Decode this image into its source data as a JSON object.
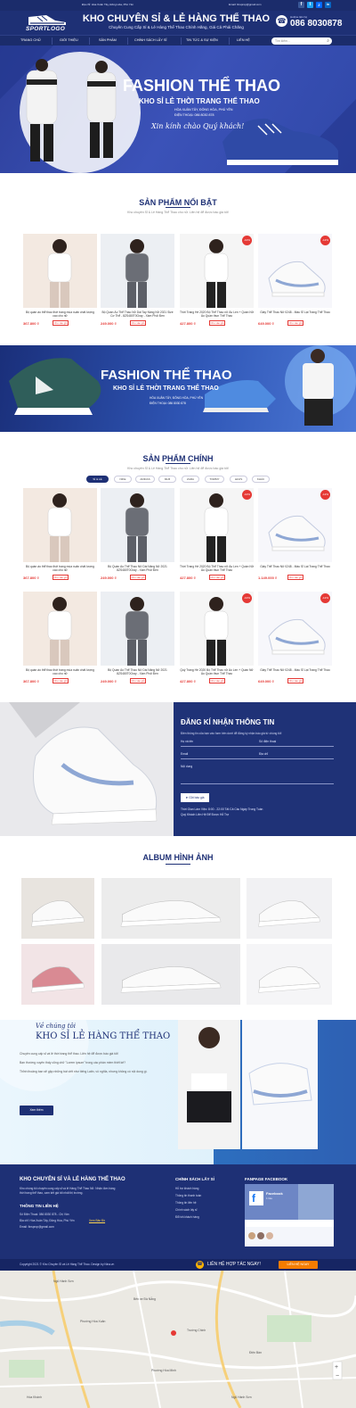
{
  "topbar": {
    "address": "Địa chỉ: Hòa Xuân Tây, Đông Hòa, Phú Yên",
    "email": "Email: ltnsprop@gmail.com",
    "social": [
      {
        "name": "facebook-icon",
        "glyph": "f",
        "color": "#3b5998"
      },
      {
        "name": "twitter-icon",
        "glyph": "t",
        "color": "#1da1f2"
      },
      {
        "name": "zalo-icon",
        "glyph": "Z",
        "color": "#0068ff"
      },
      {
        "name": "linkedin-icon",
        "glyph": "in",
        "color": "#0a66c2"
      }
    ]
  },
  "header": {
    "logo_text": "SPORTLOGO",
    "title": "KHO CHUYÊN SỈ & LẺ HÀNG THỂ THAO",
    "subtitle": "Chuyên Cung Cấp Sỉ & Lẻ Hàng Thể Thao Chính Hãng, Giá Cả Phải Chăng",
    "hotline_label": "Hotline liên hệ",
    "hotline": "086 8030878"
  },
  "nav": {
    "items": [
      "TRANG CHỦ",
      "GIỚI THIỆU",
      "SẢN PHẨM",
      "CHÍNH SÁCH LẤY SỈ",
      "TIN TỨC & SỰ KIỆN",
      "LIÊN HỆ"
    ],
    "search_placeholder": "Tìm kiếm..."
  },
  "banner1": {
    "title": "FASHION THỂ THAO",
    "subtitle": "KHO SỈ LẺ THỜI TRANG THỂ THAO",
    "address": "HÒA XUÂN TÂY, ĐÔNG HÒA, PHÚ YÊN",
    "phone": "ĐIỆN THOẠI: 086 8030 878",
    "greeting": "Xin kính chào Quý khách!"
  },
  "featured": {
    "title": "SẢN PHẨM NỔI BẬT",
    "subtitle": "Kho chuyên Sỉ & Lẻ Hàng Thể Thao cho nữ. Liên hệ để được báo giá tốt!",
    "cart_label": "Cho vào giỏ",
    "products": [
      {
        "name": "Bộ quần áo thể thao thời trang mùa xuân chất lượng cao cho nữ",
        "price": "367.800 ₫",
        "sale": ""
      },
      {
        "name": "Bộ Quần Áo Thể Thao Nữ Dài Tay Nâng Nữ 2021 Size Cơ Thể - 8ZS480T0Gray - Xám Phối Đen",
        "price": "249.000 ₫",
        "sale": ""
      },
      {
        "name": "Thời Trang Hè 2020 Bộ Thể Thao nữ Áo Len + Quần Nữ Áo Quần thun Thể Thao",
        "price": "427.800 ₫",
        "sale": "-10%"
      },
      {
        "name": "Giày Thể Thao Nữ 0248 - Màu Sĩ Lạt Trang Thể Thao",
        "price": "649.000 ₫",
        "sale": "-12%"
      }
    ]
  },
  "banner2": {
    "title": "FASHION THỂ THAO",
    "subtitle": "KHO SỈ LẺ THỜI TRANG THỂ THAO",
    "address": "HÒA XUÂN TÂY, ĐÔNG HÒA, PHÚ YÊN",
    "phone": "ĐIỆN THOẠI: 086 8030 878"
  },
  "main": {
    "title": "SẢN PHẨM CHÍNH",
    "subtitle": "Kho chuyên Sỉ & Lẻ Hàng Thể Thao cho nữ. Liên hệ để được báo giá tốt!",
    "tabs": [
      "SỈ & LẺ",
      "NIKE",
      "ADIDAS",
      "MLB",
      "ZARA",
      "TOMMY",
      "LEVIS",
      "KHÁC"
    ],
    "cart_label": "Cho vào giỏ",
    "products": [
      {
        "name": "Bộ quần áo thể thao thời trang mùa xuân chất lượng cao cho nữ",
        "price": "367.800 ₫",
        "sale": ""
      },
      {
        "name": "Bộ Quần Áo Thể Thao Nữ Dài Nâng Nữ 2021 8ZS480T0Gray - Xám Phối Đen",
        "price": "249.000 ₫",
        "sale": ""
      },
      {
        "name": "Thời Trang Hè 2020 Bộ Thể Thao nữ Áo Len + Quần Nữ Áo Quần thun Thể Thao",
        "price": "427.800 ₫",
        "sale": "-10%"
      },
      {
        "name": "Giày Thể Thao Nữ 0248 - Màu Sĩ Lạt Trang Thể Thao",
        "price": "1.149.000 ₫",
        "sale": "-12%"
      },
      {
        "name": "Bộ quần áo thể thao thời trang mùa xuân chất lượng cao cho nữ",
        "price": "367.800 ₫",
        "sale": ""
      },
      {
        "name": "Bộ Quần Áo Thể Thao Nữ Dài Nâng Nữ 2021 8ZS480T0Gray - Xám Phối Đen",
        "price": "249.000 ₫",
        "sale": ""
      },
      {
        "name": "Quý Trang Hè 2020 Bộ Thể Thao nữ Áo Len + Quần Nữ Áo Quần thun Thể Thao",
        "price": "427.800 ₫",
        "sale": "-10%"
      },
      {
        "name": "Giày Thể Thao Nữ 0248 - Màu Sĩ Lạt Trang Thể Thao",
        "price": "649.000 ₫",
        "sale": "-12%"
      }
    ]
  },
  "register": {
    "title": "ĐĂNG KÍ NHẬN THÔNG TIN",
    "desc": "Điền thông tin của bạn vào form bên dưới để đăng ký nhận báo giá từ chúng tôi!",
    "name_placeholder": "Họ và tên",
    "phone_placeholder": "Số điện thoại",
    "email_placeholder": "Email",
    "address_placeholder": "Địa chỉ",
    "content_placeholder": "Nội dung",
    "button": "Gửi báo giá",
    "hours": "Thời Gian Làm Việc: 8:00 - 22:00 Tất Cả Các Ngày Trong Tuần",
    "holiday": "Quý Khách Liên Hệ Để Được Hỗ Trợ"
  },
  "album": {
    "title": "ALBUM HÌNH ẢNH"
  },
  "about": {
    "label": "Về chúng tôi",
    "title": "KHO SỈ LẺ HÀNG THỂ THAO",
    "text1": "Chuyên cung cấp sỉ và lẻ thời trang thể thao. Liên hệ để được báo giá tốt!",
    "text2": "Bạn thường xuyên thấy cũng chữ \"Lorem ipsum\" trong các phần mềm thiết kế?",
    "text3": "Thỉnh thoảng bạn sẽ gặp những bài viết như tiếng Latin, vô nghĩa, nhưng không có nội dung gì.",
    "button": "Xem thêm"
  },
  "footer": {
    "company": "KHO CHUYÊN SỈ VÀ LẺ HÀNG THỂ THAO",
    "company_desc1": "Kho chúng tôi chuyên cung cấp sỉ và lẻ Hàng Thể Thao Nữ. Nhận đơn hàng",
    "company_desc2": "thời trang thể thao, cam kết giá tốt nhất thị trường.",
    "contact_title": "THÔNG TIN LIÊN HỆ",
    "phone": "Số Điện Thoại: 086 8030 878 - Chị Vân",
    "address": "Địa chỉ: Hòa Xuân Tây, Đông Hòa, Phú Yên",
    "map_link": "Xem Bản Đồ",
    "email": "Email: ltnsprop@gmail.com",
    "policy_title": "CHÍNH SÁCH LẤY SỈ",
    "policies": [
      "Hỗ trợ khách hàng",
      "Thông tin thanh toán",
      "Thông tin liên hệ",
      "Chính sách lấy sỉ",
      "Đổi trả khách hàng"
    ],
    "fanpage_title": "FANPAGE FACEBOOK",
    "fanpage_name": "Facebook",
    "fanpage_likes": "1 like"
  },
  "copyright": {
    "text": "Copyright 2021 © Kho Chuyên Sỉ và Lẻ Hàng Thể Thao. Design by Nina.vn",
    "hotline_label": "LIÊN HỆ HỢP TÁC NGAY!",
    "hotline_button": "LIÊN HỆ NGAY"
  },
  "map": {
    "labels": [
      "Ngũ Hành Sơn",
      "Bến xe Đà Nẵng",
      "Phường Hòa Xuân",
      "Trường Chinh",
      "Điện Bàn",
      "Hòa Khánh",
      "Ngũ Hành Sơn",
      "Phường Hòa Minh"
    ]
  }
}
